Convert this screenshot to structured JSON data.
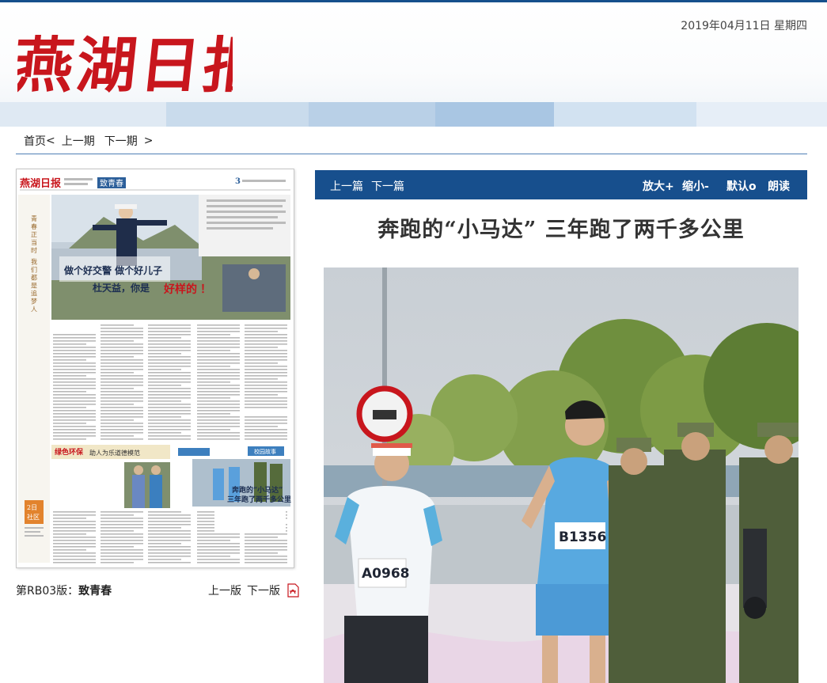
{
  "masthead": {
    "logo_text": "燕湖日报",
    "date_line": "2019年04月11日 星期四"
  },
  "nav": {
    "home": "首页",
    "home_arrow": "<",
    "prev_issue": "上一期",
    "next_issue": "下一期",
    "next_arrow": ">"
  },
  "page_thumbnail": {
    "masthead": "燕湖日报",
    "section_tab": "致青春",
    "page_number": "3",
    "headline_line1": "做个好交警   做个好儿子",
    "headline_line2_prefix": "杜天益，你是",
    "headline_line2_emph": "好样的",
    "headline_line2_suffix": "！",
    "vertical_slogan": "青春正当时 我们都是追梦人",
    "inset_tag": "绿色环保",
    "inset_subhead": "助人为乐道德模范",
    "school_tag": "校园故事",
    "caption_line1": "奔跑的“小马达”",
    "caption_line2": "三年跑了两千多公里",
    "date_badge_line1": "2日",
    "date_badge_line2": "社区"
  },
  "thumb_footer": {
    "edition_prefix": "第RB03版：",
    "edition_name": "致青春",
    "prev_edition": "上一版",
    "next_edition": "下一版"
  },
  "article_bar": {
    "prev_article": "上一篇",
    "next_article": "下一篇",
    "zoom_in": "放大+",
    "zoom_out": "缩小-",
    "default_size": "默认o",
    "read_aloud": "朗读"
  },
  "article": {
    "title": "奔跑的“小马达” 三年跑了两千多公里",
    "photo_bibs": [
      "A0968",
      "B1356"
    ]
  },
  "colors": {
    "brand_blue": "#174f8d",
    "logo_red": "#c8161d",
    "rule_blue": "#4f7fb5"
  }
}
